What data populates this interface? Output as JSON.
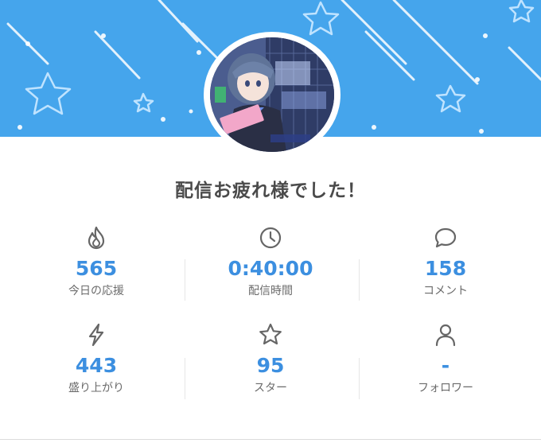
{
  "header": {
    "banner_color": "#45a5ec",
    "decoration": "stars-and-shooting-lines"
  },
  "profile": {
    "avatar_icon": "streamer-thumbnail"
  },
  "title": "配信お疲れ様でした！",
  "stats": [
    {
      "icon": "fire-icon",
      "value": "565",
      "label": "今日の応援"
    },
    {
      "icon": "clock-icon",
      "value": "0:40:00",
      "label": "配信時間"
    },
    {
      "icon": "comment-icon",
      "value": "158",
      "label": "コメント"
    },
    {
      "icon": "lightning-icon",
      "value": "443",
      "label": "盛り上がり"
    },
    {
      "icon": "star-icon",
      "value": "95",
      "label": "スター"
    },
    {
      "icon": "person-icon",
      "value": "-",
      "label": "フォロワー"
    }
  ],
  "colors": {
    "accent": "#3c8fe0",
    "label": "#6b6b6b",
    "icon": "#666666"
  }
}
